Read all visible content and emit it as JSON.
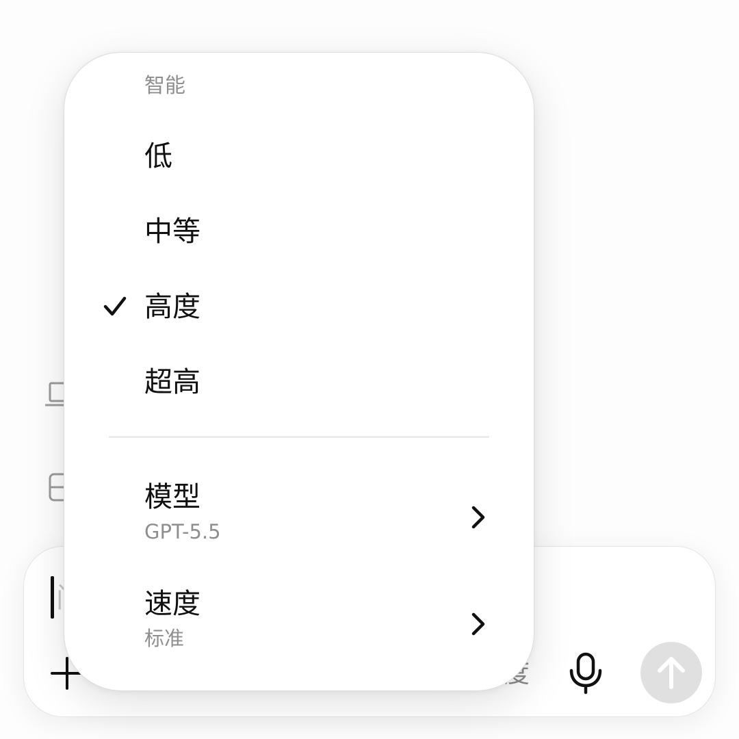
{
  "composer": {
    "placeholder_peek": "问",
    "intelligence_peek": "度",
    "icons": {
      "add": "plus-icon",
      "mic": "microphone-icon",
      "send": "arrow-up-icon"
    }
  },
  "background": {
    "icons": [
      "laptop-icon",
      "document-icon"
    ]
  },
  "menu": {
    "header": "智能",
    "items": [
      {
        "label": "低",
        "selected": false
      },
      {
        "label": "中等",
        "selected": false
      },
      {
        "label": "高度",
        "selected": true
      },
      {
        "label": "超高",
        "selected": false
      }
    ],
    "model": {
      "title": "模型",
      "value": "GPT-5.5"
    },
    "speed": {
      "title": "速度",
      "value": "标准"
    }
  },
  "colors": {
    "text_primary": "#111111",
    "text_secondary": "#8e8e8e",
    "send_disabled": "#e0e0e0"
  }
}
